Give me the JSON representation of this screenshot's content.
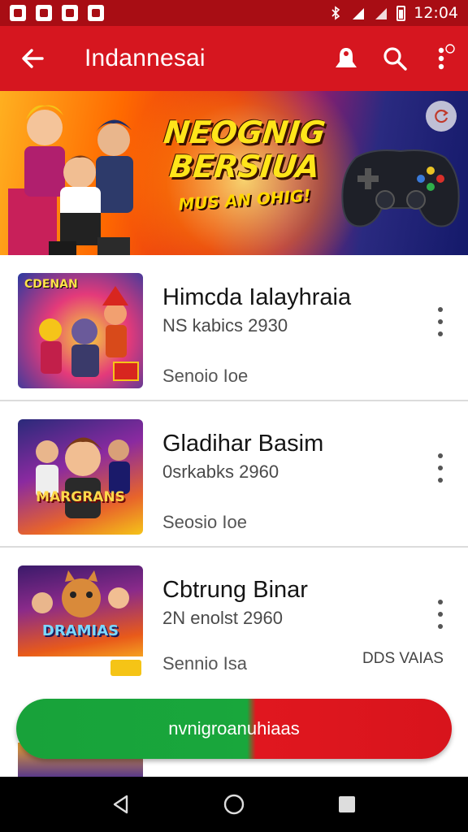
{
  "status_bar": {
    "time": "12:04",
    "icons": [
      "image-icon",
      "navigation-icon",
      "location-icon",
      "gallery-icon",
      "bluetooth-icon",
      "signal-icon",
      "signal-icon",
      "battery-icon"
    ]
  },
  "app_bar": {
    "title": "Indannesai",
    "back_icon": "arrow-left-icon",
    "actions": [
      "notification-bell-icon",
      "search-icon",
      "more-vert-icon"
    ],
    "accent": "#d6161f"
  },
  "banner": {
    "line1": "NEOGNIG",
    "line2": "BERSIUA",
    "tagline": "MUS AN OHIG!",
    "badge_icon": "refresh-icon"
  },
  "items": [
    {
      "title": "Himcda Ialayhraia",
      "subtitle": "NS kabics 2930",
      "meta": "Senoio Ioe",
      "thumb_label": "CDENAN",
      "thumb_tag": ""
    },
    {
      "title": "Gladihar Basim",
      "subtitle": "0srkabks 2960",
      "meta": "Seosio Ioe",
      "thumb_label": "MARGRANS",
      "thumb_tag": ""
    },
    {
      "title": "Cbtrung Binar",
      "subtitle": "2N enolst 2960",
      "meta": "Sennio Isa",
      "thumb_label": "DRAMIAS",
      "extra": "DDS VAIAS"
    }
  ],
  "cta": {
    "label": "nvnigroanuhiaas",
    "colors": [
      "#18a23a",
      "#e0171f"
    ]
  },
  "nav": [
    "back-icon",
    "home-icon",
    "recents-icon"
  ]
}
